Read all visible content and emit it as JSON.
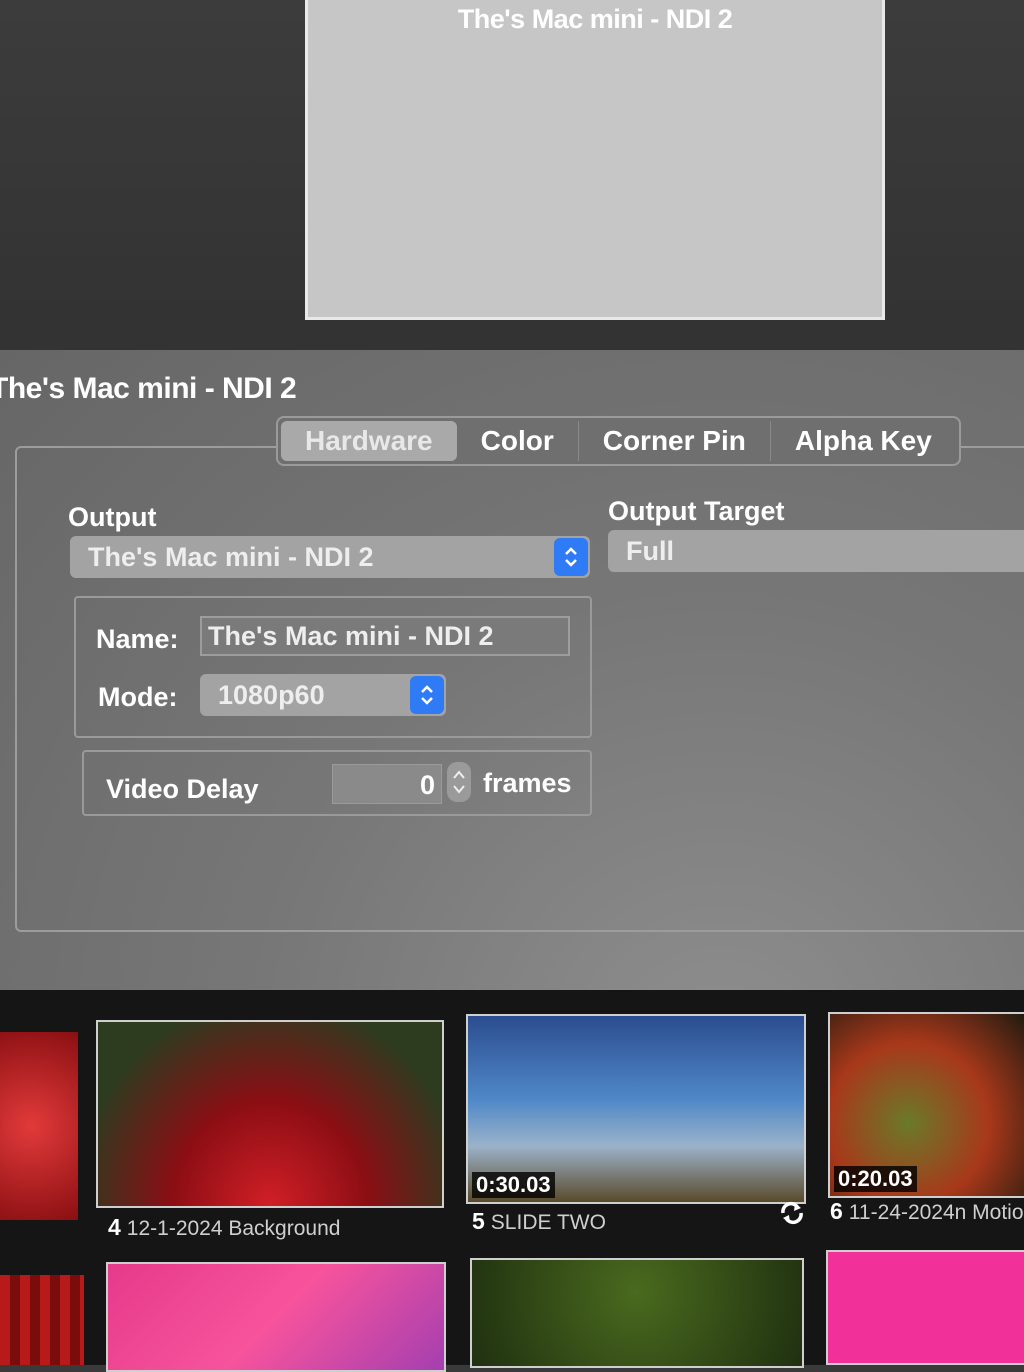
{
  "preview": {
    "title": "The's Mac mini - NDI 2"
  },
  "panel": {
    "title": "The's Mac mini - NDI 2",
    "tabs": [
      {
        "label": "Hardware",
        "active": true
      },
      {
        "label": "Color",
        "active": false
      },
      {
        "label": "Corner Pin",
        "active": false
      },
      {
        "label": "Alpha Key",
        "active": false
      }
    ],
    "output": {
      "label": "Output",
      "value": "The's Mac mini - NDI 2",
      "icon": "updown-chevron-icon"
    },
    "output_target": {
      "label": "Output Target",
      "value": "Full"
    },
    "name": {
      "label": "Name:",
      "value": "The's Mac mini - NDI 2"
    },
    "mode": {
      "label": "Mode:",
      "value": "1080p60"
    },
    "video_delay": {
      "label": "Video Delay",
      "value": "0",
      "unit": "frames"
    }
  },
  "colors": {
    "accent": "#2f7af5",
    "panel": "#7a7a7a",
    "bin": "#151515"
  },
  "bin": {
    "cues": [
      {
        "number": "4",
        "name": "12-1-2024 Background",
        "duration": ""
      },
      {
        "number": "5",
        "name": "SLIDE TWO",
        "duration": "0:30.03",
        "loop_icon": "loop-icon"
      },
      {
        "number": "6",
        "name": "11-24-2024n Motio",
        "duration": "0:20.03"
      }
    ]
  }
}
